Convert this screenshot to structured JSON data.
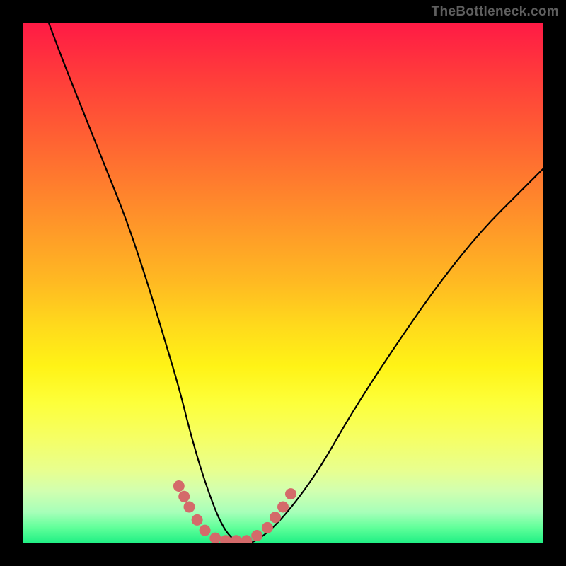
{
  "watermark": "TheBottleneck.com",
  "chart_data": {
    "type": "line",
    "title": "",
    "xlabel": "",
    "ylabel": "",
    "x_range": [
      0,
      100
    ],
    "y_range": [
      0,
      100
    ],
    "series": [
      {
        "name": "bottleneck-curve",
        "x": [
          5,
          8,
          12,
          16,
          20,
          24,
          27,
          30,
          32,
          34,
          36,
          38,
          40,
          42,
          44,
          47,
          50,
          54,
          58,
          62,
          67,
          73,
          80,
          88,
          96,
          100
        ],
        "y": [
          100,
          92,
          82,
          72,
          62,
          50,
          40,
          30,
          22,
          15,
          9,
          4,
          1,
          0,
          0,
          2,
          5,
          10,
          16,
          23,
          31,
          40,
          50,
          60,
          68,
          72
        ]
      }
    ],
    "markers": {
      "name": "highlight-dots",
      "points": [
        {
          "x": 30,
          "y": 11
        },
        {
          "x": 31,
          "y": 9
        },
        {
          "x": 32,
          "y": 7
        },
        {
          "x": 33.5,
          "y": 4.5
        },
        {
          "x": 35,
          "y": 2.5
        },
        {
          "x": 37,
          "y": 1
        },
        {
          "x": 39,
          "y": 0.5
        },
        {
          "x": 41,
          "y": 0.5
        },
        {
          "x": 43,
          "y": 0.5
        },
        {
          "x": 45,
          "y": 1.5
        },
        {
          "x": 47,
          "y": 3
        },
        {
          "x": 48.5,
          "y": 5
        },
        {
          "x": 50,
          "y": 7
        },
        {
          "x": 51.5,
          "y": 9.5
        }
      ]
    },
    "background_gradient": {
      "top": "#ff1a45",
      "mid1": "#ff9a28",
      "mid2": "#fff316",
      "bottom": "#1eef84"
    }
  }
}
